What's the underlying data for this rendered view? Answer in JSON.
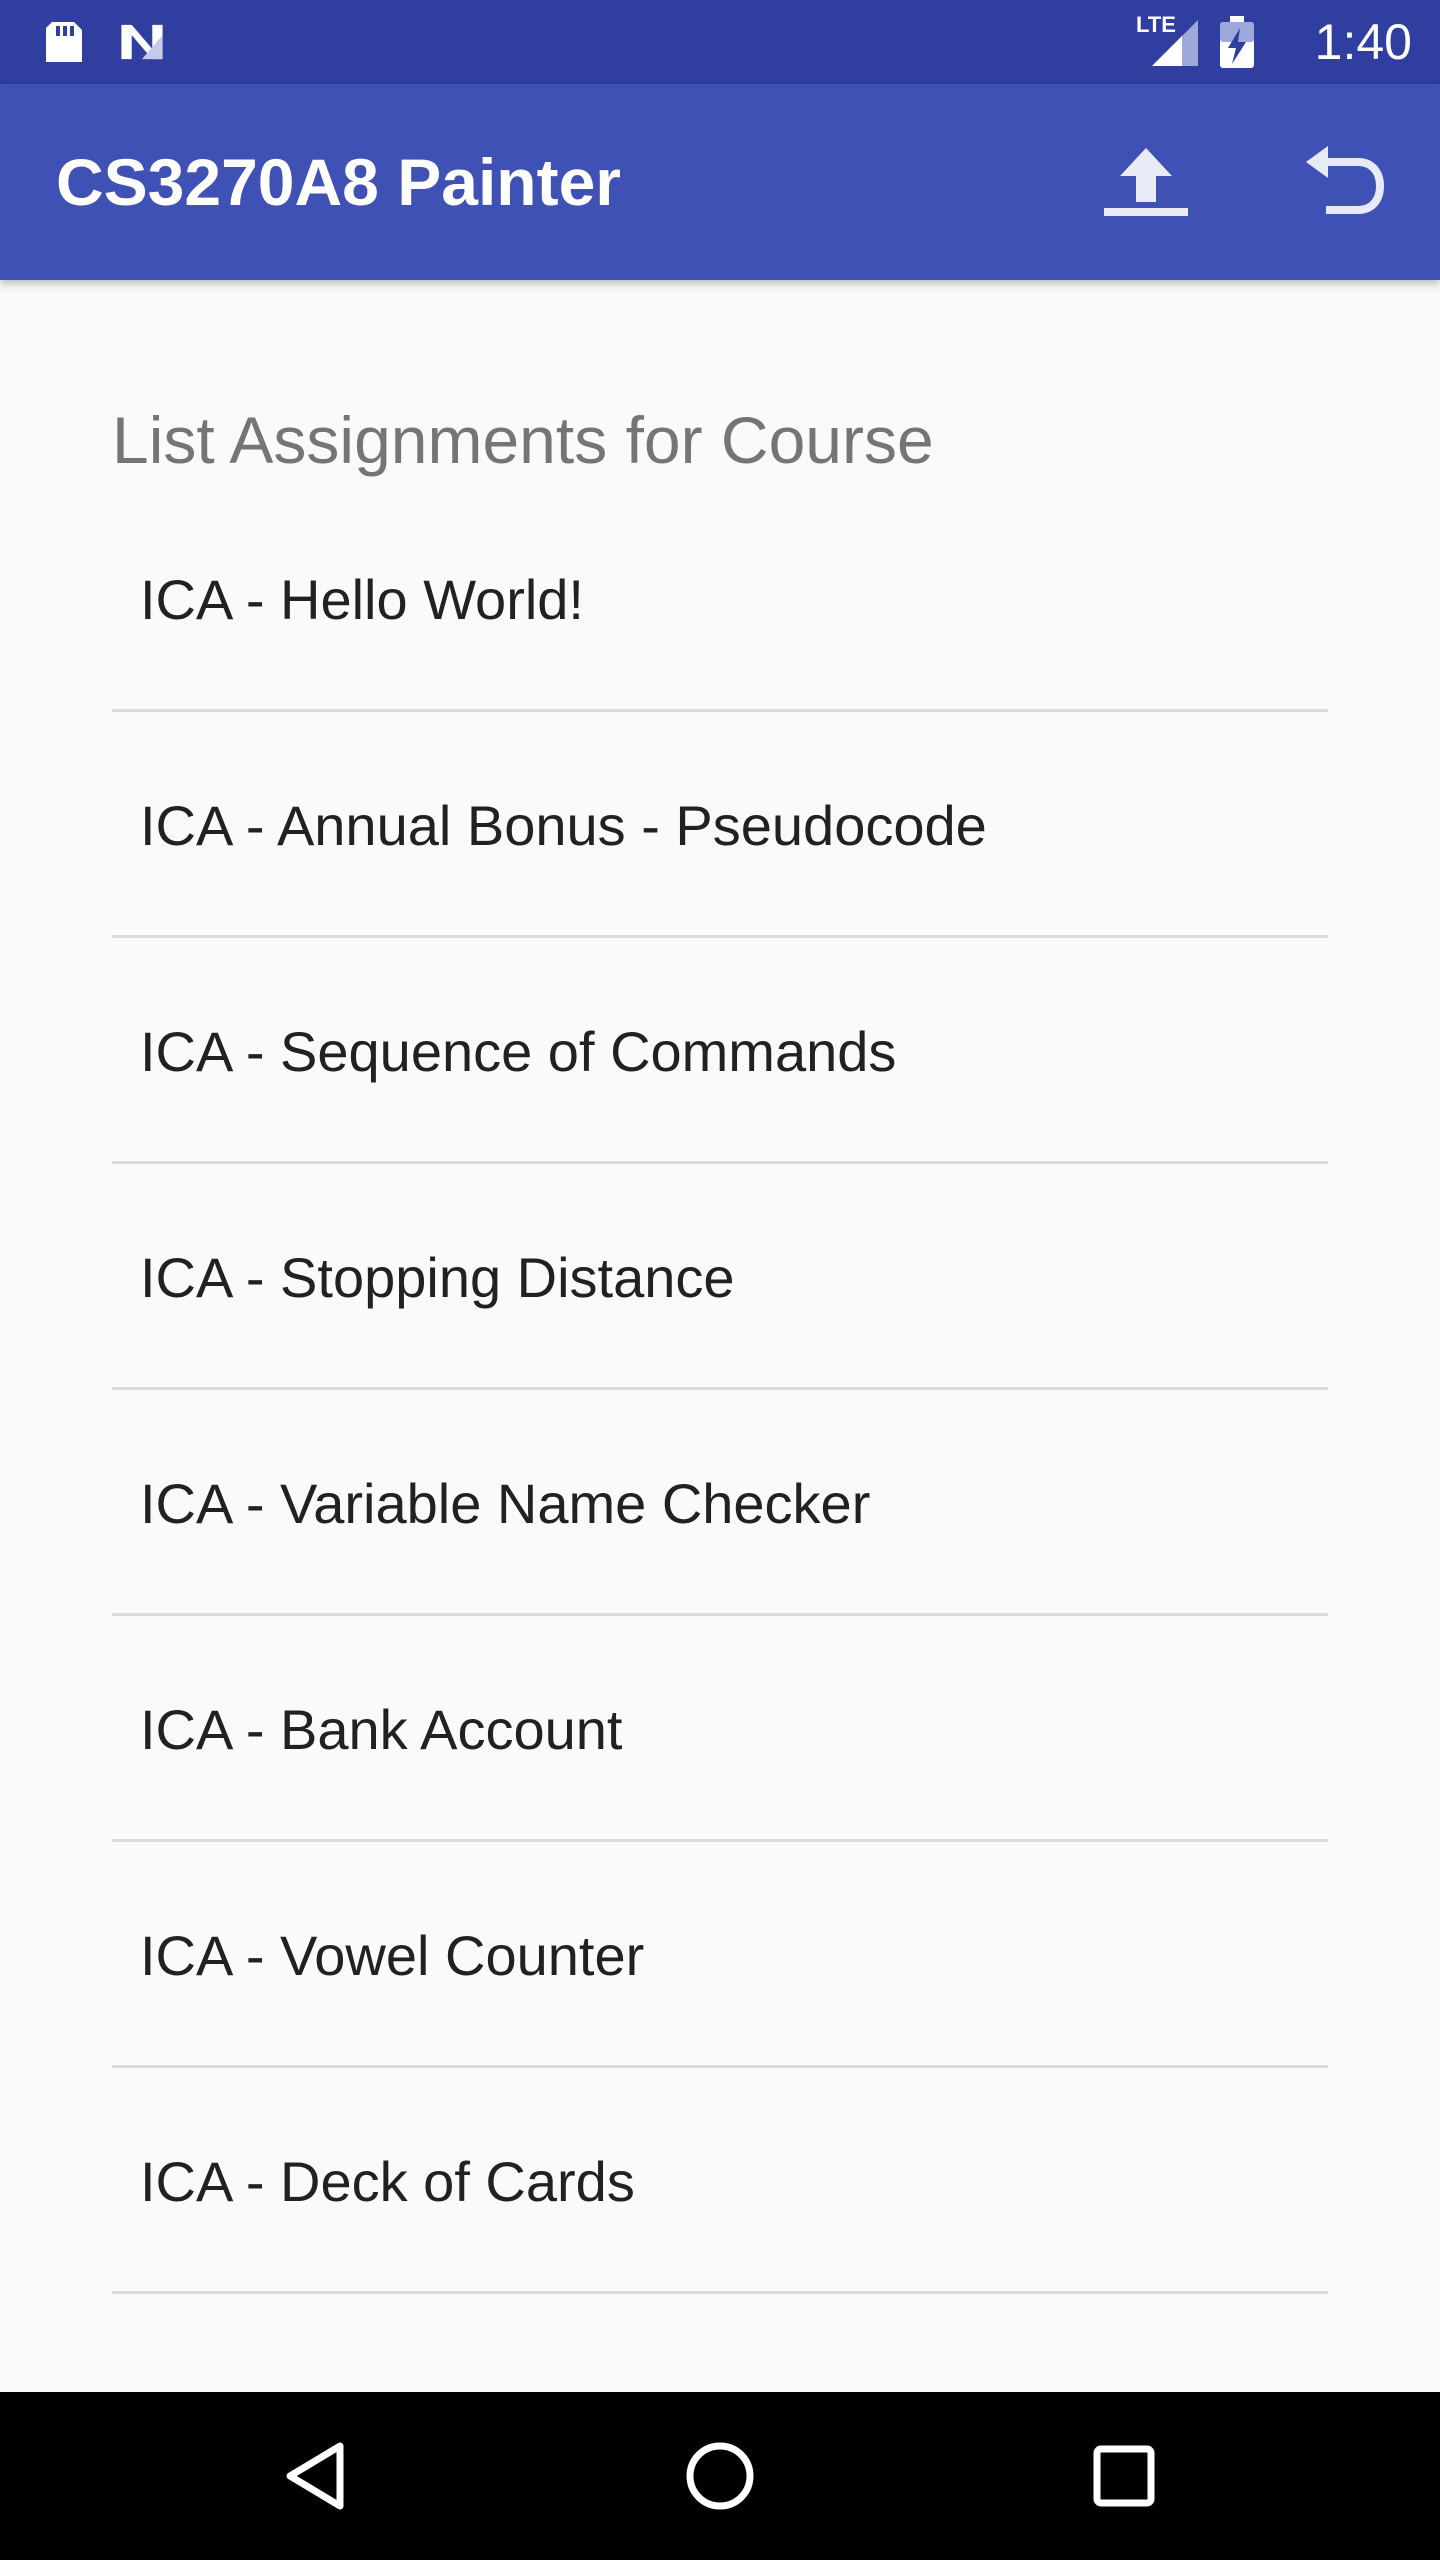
{
  "status_bar": {
    "time": "1:40",
    "network_label": "LTE",
    "icons": [
      "sd-card-icon",
      "notification-n-icon",
      "signal-icon",
      "battery-charging-icon"
    ]
  },
  "app_bar": {
    "title": "CS3270A8 Painter",
    "actions": [
      "upload-icon",
      "undo-icon"
    ]
  },
  "content": {
    "section_title": "List Assignments for Course",
    "assignments": [
      "ICA - Hello World!",
      "ICA - Annual Bonus - Pseudocode",
      "ICA - Sequence of Commands",
      "ICA - Stopping Distance",
      "ICA - Variable Name Checker",
      "ICA - Bank Account",
      "ICA - Vowel Counter",
      "ICA - Deck of Cards"
    ]
  },
  "nav_bar": {
    "buttons": [
      "back-icon",
      "home-icon",
      "recents-icon"
    ]
  },
  "colors": {
    "status_bar": "#303f9f",
    "app_bar": "#3f51b5",
    "background": "#fafafa",
    "nav_bar": "#000000"
  }
}
